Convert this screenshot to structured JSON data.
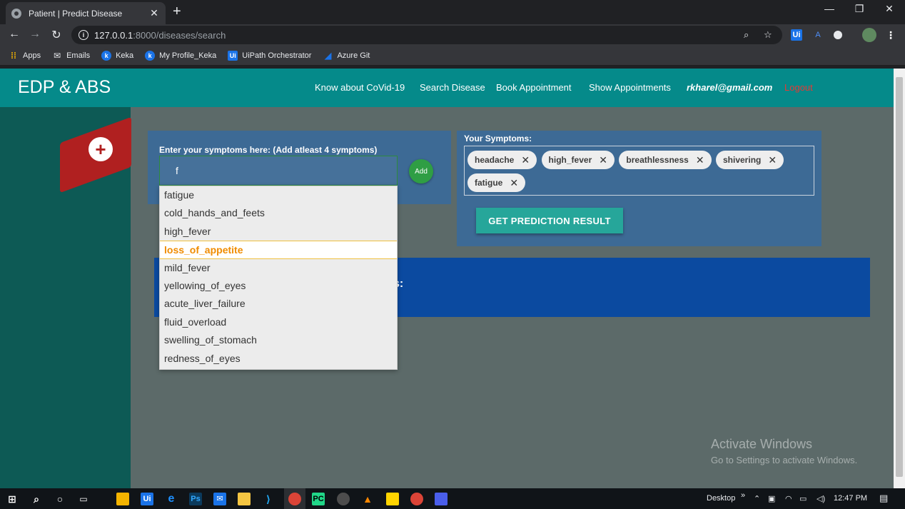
{
  "browser": {
    "tab_title": "Patient | Predict Disease",
    "tab_close": "✕",
    "new_tab": "+",
    "url_host": "127.0.0.1",
    "url_path": ":8000/diseases/search",
    "window_controls": {
      "minimize": "—",
      "restore": "❐",
      "close": "✕"
    },
    "icons": [
      "back-icon",
      "forward-icon",
      "reload-icon",
      "info-icon",
      "zoom-icon",
      "star-icon"
    ]
  },
  "bookmarks": [
    {
      "label": "Apps",
      "icon": "apps-grid-icon",
      "color": "#f4b400"
    },
    {
      "label": "Emails",
      "icon": "mail-icon",
      "color": "#e8eaed"
    },
    {
      "label": "Keka",
      "icon": "keka-icon",
      "color": "#1a73e8"
    },
    {
      "label": "My Profile_Keka",
      "icon": "keka-icon",
      "color": "#1a73e8"
    },
    {
      "label": "UiPath Orchestrator",
      "icon": "uipath-icon",
      "color": "#1a73e8"
    },
    {
      "label": "Azure Git",
      "icon": "azure-icon",
      "color": "#1a73e8"
    }
  ],
  "navbar": {
    "brand": "EDP & ABS",
    "links": {
      "covid": "Know about CoVid-19",
      "search": "Search Disease",
      "book": "Book Appointment",
      "show": "Show Appointments",
      "email": "rkharel@gmail.com",
      "logout": "Logout"
    },
    "colors": {
      "background": "#058a8a",
      "logout": "#e53935"
    }
  },
  "symptom_input": {
    "label": "Enter your symptoms here: (Add atleast 4 symptoms)",
    "value": "f",
    "add_label": "Add"
  },
  "autocomplete": {
    "items": [
      "fatigue",
      "cold_hands_and_feets",
      "high_fever",
      "loss_of_appetite",
      "mild_fever",
      "yellowing_of_eyes",
      "acute_liver_failure",
      "fluid_overload",
      "swelling_of_stomach",
      "redness_of_eyes"
    ],
    "highlighted": "loss_of_appetite"
  },
  "your_symptoms": {
    "title": "Your Symptoms:",
    "chips": [
      "headache",
      "high_fever",
      "breathlessness",
      "shivering",
      "fatigue"
    ],
    "remove_glyph": "✕"
  },
  "predict_button": "GET PREDICTION RESULT",
  "results": {
    "text": "s:"
  },
  "watermark": {
    "line1": "Activate Windows",
    "line2": "Go to Settings to activate Windows."
  },
  "taskbar": {
    "desktop_label": "Desktop",
    "chevron": "»",
    "time": "12:47 PM"
  }
}
